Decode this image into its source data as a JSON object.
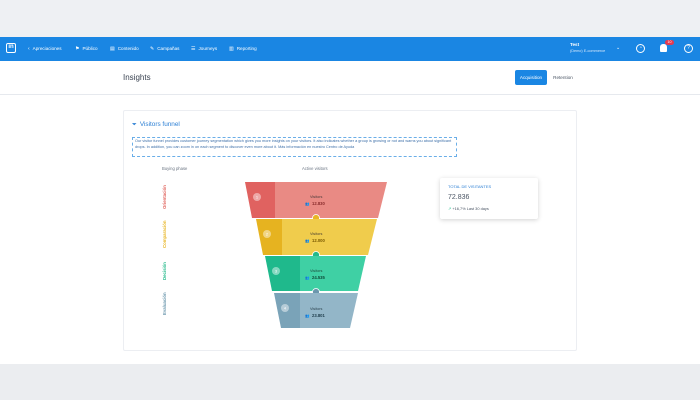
{
  "navbar": {
    "logo_text": "in",
    "back_icon": "back-arrow-icon",
    "items": [
      {
        "label": "Apreciaciones",
        "icon": "‹"
      },
      {
        "label": "Público",
        "icon": "⚑"
      },
      {
        "label": "Contenido",
        "icon": "▤"
      },
      {
        "label": "Campañas",
        "icon": "✎"
      },
      {
        "label": "Journeys",
        "icon": "☰"
      },
      {
        "label": "Reporting",
        "icon": "▥"
      }
    ],
    "account_name": "Test",
    "account_sub": "(Demo) E-commerce",
    "notification_count": "10",
    "accent_color": "#1a86e3"
  },
  "header": {
    "title": "Insights",
    "tabs": [
      {
        "label": "Acquisition",
        "active": true
      },
      {
        "label": "Retention",
        "active": false
      }
    ]
  },
  "funnel_card": {
    "title": "Visitors funnel",
    "title_icon": "filter-icon",
    "description": "Our visitor funnel provides customer journey segmentation which gives you more insights on your visitors. It also indicates whether a group is growing or not and warns you about significant drops. In addition, you can zoom in on each segment to discover even more about it. Más información en nuestro Centro de Ayuda",
    "col_buying_phase": "Buying phase",
    "col_active_visitors": "Active visitors",
    "phases": [
      {
        "label": "Orientación",
        "color": "#e0625b"
      },
      {
        "label": "Comparación",
        "color": "#e8b626"
      },
      {
        "label": "Decisión",
        "color": "#24b98a"
      },
      {
        "label": "Evaluación",
        "color": "#6b97ad"
      }
    ],
    "segments": [
      {
        "label": "Visitors",
        "value": "12.830",
        "dark": "#e06260",
        "light": "#e98a84",
        "badge": "1"
      },
      {
        "label": "Visitors",
        "value": "12.000",
        "dark": "#e6b320",
        "light": "#f0cc4c",
        "badge": "2"
      },
      {
        "label": "Visitors",
        "value": "24.535",
        "dark": "#1fb98c",
        "light": "#3fd0a4",
        "badge": "3"
      },
      {
        "label": "Visitors",
        "value": "23.801",
        "dark": "#7aa3b8",
        "light": "#93b6c8",
        "badge": "4"
      }
    ]
  },
  "tooltip": {
    "title": "TOTAL DE VISITANTES",
    "value": "72.836",
    "delta": "+16,7% Last 30 days"
  }
}
